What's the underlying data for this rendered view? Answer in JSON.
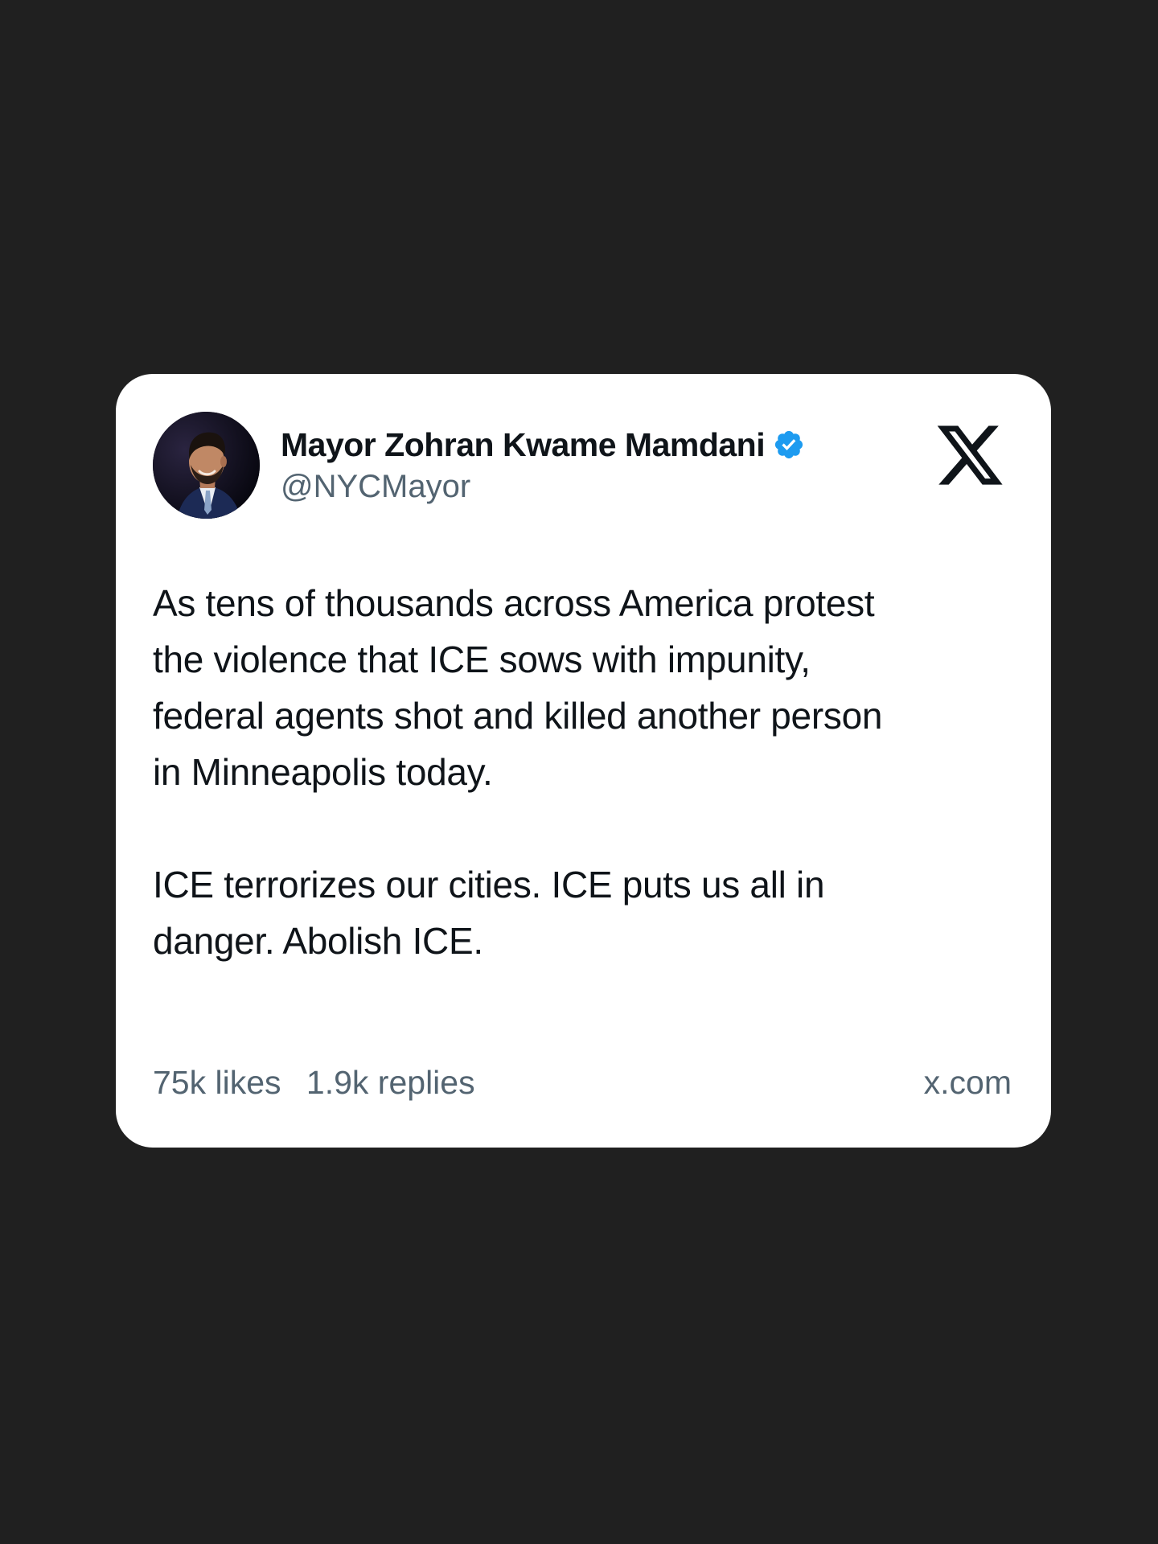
{
  "post": {
    "author": {
      "display_name": "Mayor Zohran Kwame Mamdani",
      "handle": "@NYCMayor",
      "verified_icon": "verified-badge-icon",
      "avatar": "avatar-photo"
    },
    "platform_icon": "x-logo-icon",
    "body_paragraphs": [
      "As tens of thousands across America protest\nthe violence that ICE sows with impunity,\nfederal agents shot and killed another person\nin Minneapolis today.",
      "ICE terrorizes our cities. ICE puts us all in\ndanger. Abolish ICE."
    ],
    "stats": {
      "likes": "75k likes",
      "replies": "1.9k replies"
    },
    "source_domain": "x.com"
  },
  "colors": {
    "page_background": "#202020",
    "card_background": "#ffffff",
    "text_primary": "#0f1419",
    "text_secondary": "#536471",
    "verified_blue": "#1d9bf0"
  }
}
